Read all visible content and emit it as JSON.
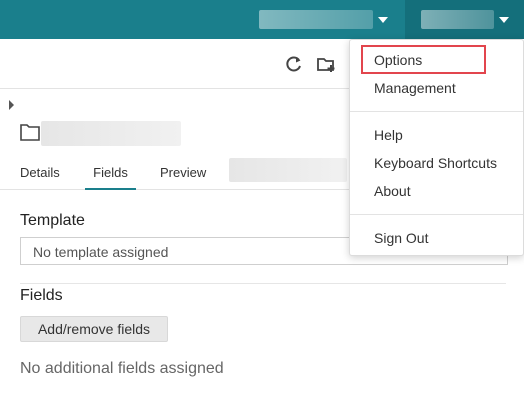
{
  "toolbar": {
    "refresh_icon": "refresh-icon",
    "new_folder_icon": "new-folder-icon"
  },
  "tabs": [
    {
      "label": "Details"
    },
    {
      "label": "Fields"
    },
    {
      "label": "Preview"
    }
  ],
  "template": {
    "title": "Template",
    "value": "No template assigned"
  },
  "fields": {
    "title": "Fields",
    "button_label": "Add/remove fields",
    "empty_text": "No additional fields assigned"
  },
  "menu": {
    "items": [
      {
        "label": "Options"
      },
      {
        "label": "Management"
      },
      {
        "label": "Help"
      },
      {
        "label": "Keyboard Shortcuts"
      },
      {
        "label": "About"
      },
      {
        "label": "Sign Out"
      }
    ]
  },
  "colors": {
    "topbar": "#1a7f8c",
    "accent": "#1a7f8c",
    "highlight": "#e2454d"
  }
}
